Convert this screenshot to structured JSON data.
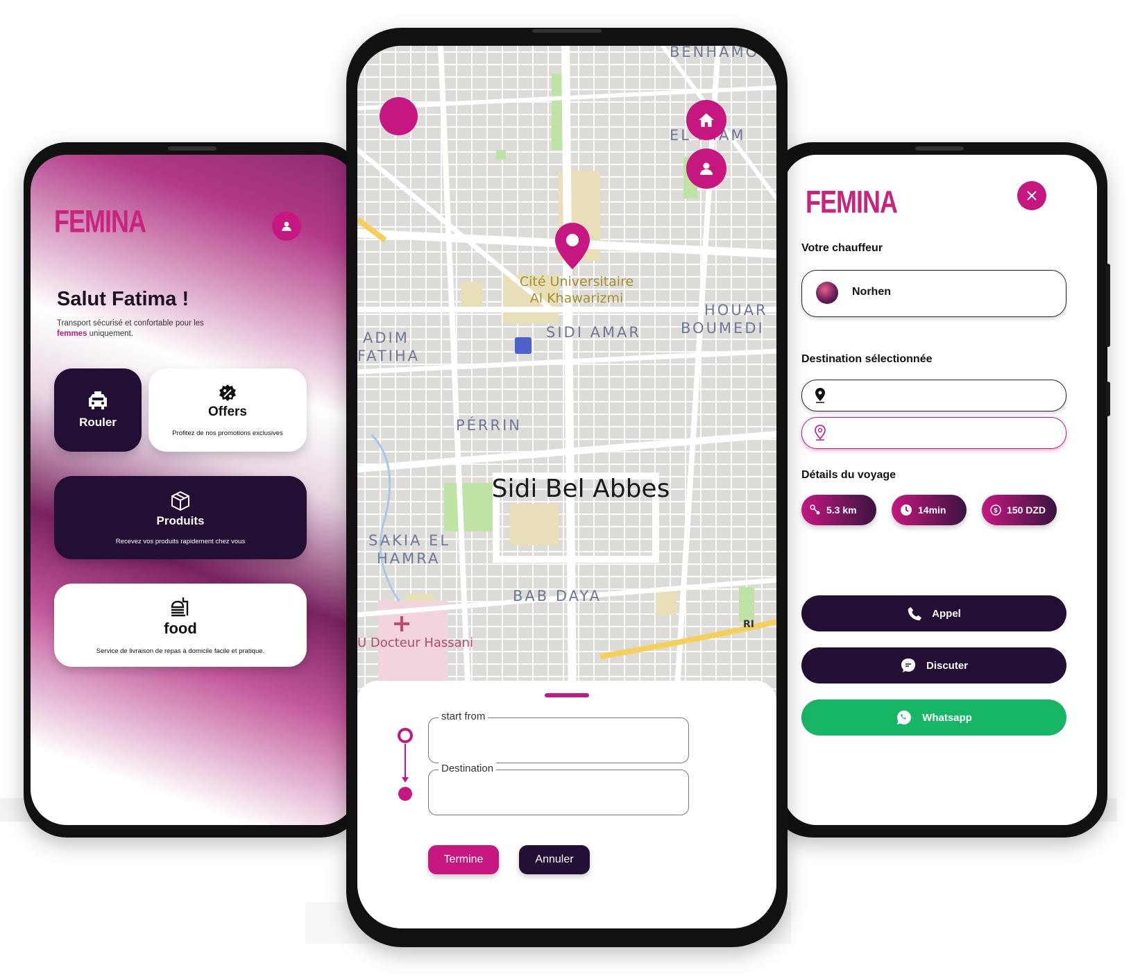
{
  "left_screen": {
    "brand": "FEMINA",
    "greeting": "Salut Fatima !",
    "subtitle_pre": "Transport sécurisé et confortable pour les ",
    "subtitle_highlight": "femmes",
    "subtitle_post": " uniquement.",
    "tiles": {
      "rouler": {
        "title": "Rouler",
        "icon": "taxi-icon"
      },
      "offers": {
        "title": "Offers",
        "desc": "Profitez de nos promotions exclusives",
        "icon": "percent-badge-icon"
      },
      "produits": {
        "title": "Produits",
        "desc": "Recevez vos produits rapidement chez vous",
        "icon": "package-icon"
      },
      "food": {
        "title": "food",
        "desc": "Service de livraison de repas à domicile facile et pratique.",
        "icon": "food-icon"
      }
    }
  },
  "center_screen": {
    "map_labels": {
      "city": "Sidi Bel Abbes",
      "poi_line1": "Cité Universitaire",
      "poi_line2": "Al Khawarizmi",
      "benhamou": "BENHAMO",
      "el_imam": "EL IMAM",
      "sidi_amar": "SIDI AMAR",
      "houari1": "HOUAR",
      "houari2": "BOUMEDI",
      "adim1": "ADIM",
      "adim2": "FATIHA",
      "perrin": "PÉRRIN",
      "sakia1": "SAKIA EL",
      "sakia2": "HAMRA",
      "bab_daya": "BAB DAYA",
      "hospital": "U Docteur Hassani",
      "road_sign": "RI"
    },
    "start_label": "start from",
    "destination_label": "Destination",
    "confirm_button": "Termine",
    "cancel_button": "Annuler"
  },
  "right_screen": {
    "brand": "FEMINA",
    "driver_label": "Votre chauffeur",
    "driver_name": "Norhen",
    "destination_label": "Destination sélectionnée",
    "details_label": "Détails du voyage",
    "distance": "5.3 km",
    "duration": "14min",
    "price": "150 DZD",
    "call_button": "Appel",
    "chat_button": "Discuter",
    "whatsapp_button": "Whatsapp"
  },
  "colors": {
    "brand_pink": "#c5177f",
    "dark_purple": "#220f33",
    "whatsapp_green": "#17b665"
  }
}
